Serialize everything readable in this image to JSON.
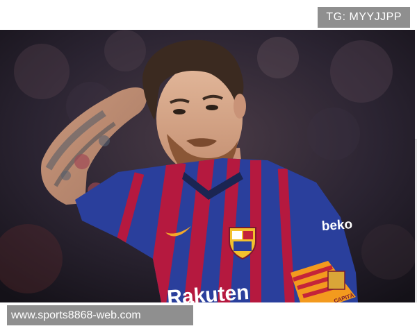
{
  "watermark": {
    "tag": "TG: MYYJJPP",
    "url": "www.sports8868-web.com"
  },
  "jersey": {
    "sponsor": "Rakuten",
    "sleeve_sponsor": "beko",
    "armband": "CAPITÀ"
  },
  "colors": {
    "background": "#ffffff",
    "overlay": "#8f8f8f",
    "jersey_blue": "#2a3f9c",
    "jersey_red": "#b5193f",
    "armband": "#f39a1e"
  }
}
